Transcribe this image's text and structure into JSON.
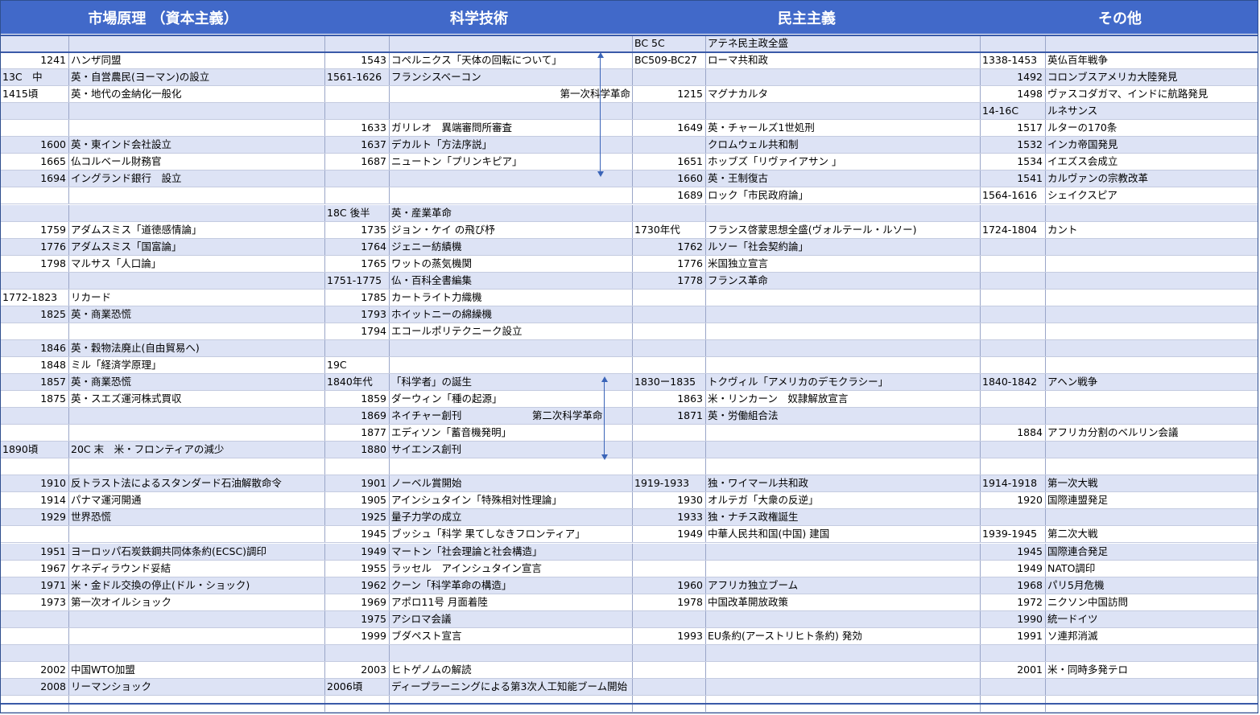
{
  "headers": [
    "市場原理 （資本主義）",
    "科学技術",
    "民主主義",
    "その他"
  ],
  "rows": [
    [
      "",
      "",
      "",
      "",
      "BC 5C",
      "アテネ民主政全盛",
      "",
      ""
    ],
    [
      "1241",
      "ハンザ同盟",
      "1543",
      "コペルニクス「天体の回転について」",
      "BC509-BC27",
      "ローマ共和政",
      "1338-1453",
      "英仏百年戦争"
    ],
    [
      "13C　中",
      "英・自営農民(ヨーマン)の設立",
      "1561-1626",
      "フランシスベーコン",
      "",
      "",
      "1492",
      "コロンブスアメリカ大陸発見"
    ],
    [
      "1415頃",
      "英・地代の金納化一般化",
      "",
      "第一次科学革命",
      "1215",
      "マグナカルタ",
      "1498",
      "ヴァスコダガマ、インドに航路発見"
    ],
    [
      "",
      "",
      "",
      "",
      "",
      "",
      "14-16C",
      "ルネサンス"
    ],
    [
      "",
      "",
      "1633",
      "ガリレオ　異端審問所審査",
      "1649",
      "英・チャールズ1世処刑",
      "1517",
      "ルターの170条"
    ],
    [
      "1600",
      "英・東インド会社設立",
      "1637",
      "デカルト「方法序説」",
      "",
      "クロムウェル共和制",
      "1532",
      "インカ帝国発見"
    ],
    [
      "1665",
      "仏コルベール財務官",
      "1687",
      "ニュートン「プリンキピア」",
      "1651",
      "ホッブズ「リヴァイアサン 」",
      "1534",
      "イエズス会成立"
    ],
    [
      "1694",
      "イングランド銀行　設立",
      "",
      "",
      "1660",
      "英・王制復古",
      "1541",
      "カルヴァンの宗教改革"
    ],
    [
      "",
      "",
      "",
      "",
      "1689",
      "ロック「市民政府論」",
      "1564-1616",
      "シェイクスピア"
    ],
    [
      "",
      "",
      "18C 後半",
      "英・産業革命",
      "",
      "",
      "",
      ""
    ],
    [
      "1759",
      "アダムスミス「道徳感情論」",
      "1735",
      "ジョン・ケイ の飛び杼",
      "1730年代",
      "フランス啓蒙思想全盛(ヴォルテール・ルソー)",
      "1724-1804",
      "カント"
    ],
    [
      "1776",
      "アダムスミス「国富論」",
      "1764",
      "ジェニー紡績機",
      "1762",
      "ルソー「社会契約論」",
      "",
      ""
    ],
    [
      "1798",
      "マルサス「人口論」",
      "1765",
      "ワットの蒸気機関",
      "1776",
      "米国独立宣言",
      "",
      ""
    ],
    [
      "",
      "",
      "1751-1775",
      "仏・百科全書編集",
      "1778",
      "フランス革命",
      "",
      ""
    ],
    [
      "1772-1823",
      "リカード",
      "1785",
      "カートライト力織機",
      "",
      "",
      "",
      ""
    ],
    [
      "1825",
      "英・商業恐慌",
      "1793",
      "ホイットニーの綿繰機",
      "",
      "",
      "",
      ""
    ],
    [
      "",
      "",
      "1794",
      "エコールポリテクニーク設立",
      "",
      "",
      "",
      ""
    ],
    [
      "1846",
      "英・穀物法廃止(自由貿易へ)",
      "",
      "",
      "",
      "",
      "",
      ""
    ],
    [
      "1848",
      "ミル「経済学原理」",
      "19C",
      "",
      "",
      "",
      "",
      ""
    ],
    [
      "1857",
      "英・商業恐慌",
      "1840年代",
      "「科学者」の誕生",
      "1830ー1835",
      "トクヴィル「アメリカのデモクラシー」",
      "1840-1842",
      "アヘン戦争"
    ],
    [
      "1875",
      "英・スエズ運河株式買収",
      "1859",
      "ダーウィン「種の起源」",
      "1863",
      "米・リンカーン　奴隷解放宣言",
      "",
      ""
    ],
    [
      "",
      "",
      "1869",
      "ネイチャー創刊　　　　　　　第二次科学革命",
      "1871",
      "英・労働組合法",
      "",
      ""
    ],
    [
      "",
      "",
      "1877",
      "エディソン「蓄音機発明」",
      "",
      "",
      "1884",
      "アフリカ分割のベルリン会議"
    ],
    [
      "1890頃",
      "20C 末　米・フロンティアの減少",
      "1880",
      "サイエンス創刊",
      "",
      "",
      "",
      ""
    ],
    [
      "",
      "",
      "",
      "",
      "",
      "",
      "",
      ""
    ],
    [
      "1910",
      "反トラスト法によるスタンダード石油解散命令",
      "1901",
      "ノーベル賞開始",
      "1919-1933",
      "独・ワイマール共和政",
      "1914-1918",
      "第一次大戦"
    ],
    [
      "1914",
      "パナマ運河開通",
      "1905",
      "アインシュタイン「特殊相対性理論」",
      "1930",
      "オルテガ「大衆の反逆」",
      "1920",
      "国際連盟発足"
    ],
    [
      "1929",
      "世界恐慌",
      "1925",
      "量子力学の成立",
      "1933",
      "独・ナチス政権誕生",
      "",
      ""
    ],
    [
      "",
      "",
      "1945",
      "ブッシュ「科学 果てしなきフロンティア」",
      "1949",
      "中華人民共和国(中国) 建国",
      "1939-1945",
      "第二次大戦"
    ],
    [
      "1951",
      "ヨーロッパ石炭鉄鋼共同体条約(ECSC)調印",
      "1949",
      "マートン「社会理論と社会構造」",
      "",
      "",
      "1945",
      "国際連合発足"
    ],
    [
      "1967",
      "ケネディラウンド妥結",
      "1955",
      "ラッセル　アインシュタイン宣言",
      "",
      "",
      "1949",
      "NATO調印"
    ],
    [
      "1971",
      "米・金ドル交換の停止(ドル・ショック)",
      "1962",
      "クーン「科学革命の構造」",
      "1960",
      "アフリカ独立ブーム",
      "1968",
      "パリ5月危機"
    ],
    [
      "1973",
      "第一次オイルショック",
      "1969",
      "アポロ11号 月面着陸",
      "1978",
      "中国改革開放政策",
      "1972",
      "ニクソン中国訪問"
    ],
    [
      "",
      "",
      "1975",
      "アシロマ会議",
      "",
      "",
      "1990",
      "統一ドイツ"
    ],
    [
      "",
      "",
      "1999",
      "ブダペスト宣言",
      "1993",
      "EU条約(アーストリヒト条約) 発効",
      "1991",
      "ソ連邦消滅"
    ],
    [
      "",
      "",
      "",
      "",
      "",
      "",
      "",
      ""
    ],
    [
      "2002",
      "中国WTO加盟",
      "2003",
      "ヒトゲノムの解読",
      "",
      "",
      "2001",
      "米・同時多発テロ"
    ],
    [
      "2008",
      "リーマンショック",
      "2006頃",
      "ディープラーニングによる第3次人工知能ブーム開始",
      "",
      "",
      "",
      ""
    ],
    [
      "",
      "",
      "",
      "",
      "",
      "",
      "",
      ""
    ]
  ],
  "colors": {
    "header_bg": "#4169c9",
    "header_text": "#ffffff",
    "row_alt": "#dde3f5",
    "row_white": "#ffffff",
    "grid_line": "#9aa6c8",
    "arrow": "#3a64b8"
  }
}
